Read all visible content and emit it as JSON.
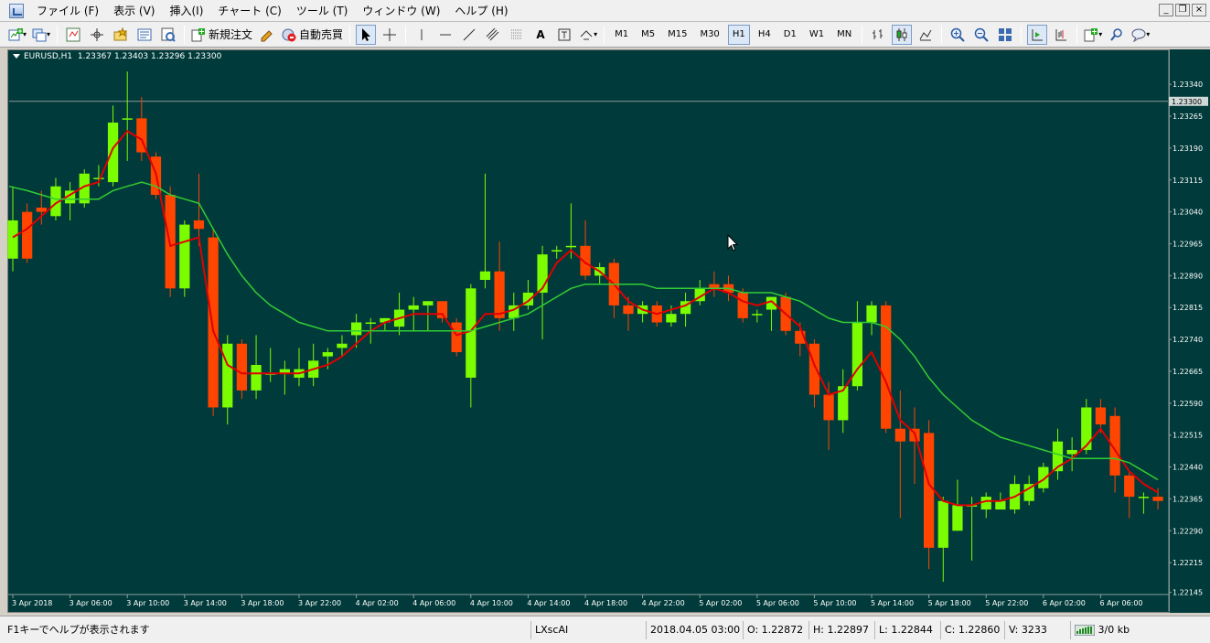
{
  "menu": {
    "items": [
      "ファイル (F)",
      "表示 (V)",
      "挿入(I)",
      "チャート (C)",
      "ツール (T)",
      "ウィンドウ (W)",
      "ヘルプ (H)"
    ]
  },
  "toolbar": {
    "new_order_label": "新規注文",
    "auto_trade_label": "自動売買",
    "text_tool_label": "A",
    "timeframes": [
      "M1",
      "M5",
      "M15",
      "M30",
      "H1",
      "H4",
      "D1",
      "W1",
      "MN"
    ],
    "active_timeframe": "H1"
  },
  "chart_header": {
    "symbol": "EURUSD,H1",
    "ohlc": "1.23367 1.23403 1.23296 1.23300"
  },
  "status": {
    "help": "F1キーでヘルプが表示されます",
    "profile": "LXscAI",
    "datetime": "2018.04.05 03:00",
    "open": "O: 1.22872",
    "high": "H: 1.22897",
    "low": "L: 1.22844",
    "close": "C: 1.22860",
    "volume": "V: 3233",
    "traffic": "3/0 kb"
  },
  "colors": {
    "background": "#003a3a",
    "bull": "#7cfc00",
    "bear": "#ff4500",
    "ma_fast": "#e00000",
    "ma_slow": "#32cd32",
    "axis_text": "#ffffff",
    "bid_line": "#8a9a9a"
  },
  "chart_data": {
    "type": "candlestick",
    "symbol": "EURUSD",
    "timeframe": "H1",
    "ylim": [
      1.2214,
      1.2342
    ],
    "y_ticks": [
      "1.23340",
      "1.23265",
      "1.23190",
      "1.23115",
      "1.23040",
      "1.22965",
      "1.22890",
      "1.22815",
      "1.22740",
      "1.22665",
      "1.22590",
      "1.22515",
      "1.22440",
      "1.22365",
      "1.22290",
      "1.22215",
      "1.22145"
    ],
    "current_price": "1.23300",
    "x_labels": [
      "3 Apr 2018",
      "3 Apr 06:00",
      "3 Apr 10:00",
      "3 Apr 14:00",
      "3 Apr 18:00",
      "3 Apr 22:00",
      "4 Apr 02:00",
      "4 Apr 06:00",
      "4 Apr 10:00",
      "4 Apr 14:00",
      "4 Apr 18:00",
      "4 Apr 22:00",
      "5 Apr 02:00",
      "5 Apr 06:00",
      "5 Apr 10:00",
      "5 Apr 14:00",
      "5 Apr 18:00",
      "5 Apr 22:00",
      "6 Apr 02:00",
      "6 Apr 06:00"
    ],
    "candles": [
      {
        "o": 1.2293,
        "h": 1.231,
        "l": 1.229,
        "c": 1.2302
      },
      {
        "o": 1.2304,
        "h": 1.2306,
        "l": 1.2292,
        "c": 1.2293
      },
      {
        "o": 1.2305,
        "h": 1.2309,
        "l": 1.2301,
        "c": 1.2304
      },
      {
        "o": 1.2303,
        "h": 1.2312,
        "l": 1.2302,
        "c": 1.231
      },
      {
        "o": 1.2306,
        "h": 1.2311,
        "l": 1.2302,
        "c": 1.2309
      },
      {
        "o": 1.2306,
        "h": 1.2314,
        "l": 1.2305,
        "c": 1.2313
      },
      {
        "o": 1.2312,
        "h": 1.2315,
        "l": 1.231,
        "c": 1.2312
      },
      {
        "o": 1.2311,
        "h": 1.2329,
        "l": 1.231,
        "c": 1.2325
      },
      {
        "o": 1.2326,
        "h": 1.2337,
        "l": 1.2316,
        "c": 1.2326
      },
      {
        "o": 1.2326,
        "h": 1.2331,
        "l": 1.2316,
        "c": 1.2318
      },
      {
        "o": 1.2317,
        "h": 1.2318,
        "l": 1.2307,
        "c": 1.2308
      },
      {
        "o": 1.2308,
        "h": 1.231,
        "l": 1.2284,
        "c": 1.2286
      },
      {
        "o": 1.2286,
        "h": 1.2302,
        "l": 1.2284,
        "c": 1.2301
      },
      {
        "o": 1.2302,
        "h": 1.2313,
        "l": 1.2296,
        "c": 1.23
      },
      {
        "o": 1.2298,
        "h": 1.23,
        "l": 1.2256,
        "c": 1.2258
      },
      {
        "o": 1.2258,
        "h": 1.2275,
        "l": 1.2254,
        "c": 1.2273
      },
      {
        "o": 1.2273,
        "h": 1.2274,
        "l": 1.226,
        "c": 1.2262
      },
      {
        "o": 1.2262,
        "h": 1.2275,
        "l": 1.226,
        "c": 1.2268
      },
      {
        "o": 1.2266,
        "h": 1.2272,
        "l": 1.2264,
        "c": 1.2266
      },
      {
        "o": 1.2266,
        "h": 1.2269,
        "l": 1.2261,
        "c": 1.2267
      },
      {
        "o": 1.2265,
        "h": 1.2272,
        "l": 1.2263,
        "c": 1.2267
      },
      {
        "o": 1.2265,
        "h": 1.2273,
        "l": 1.2263,
        "c": 1.2269
      },
      {
        "o": 1.227,
        "h": 1.2272,
        "l": 1.2267,
        "c": 1.2271
      },
      {
        "o": 1.2272,
        "h": 1.2275,
        "l": 1.227,
        "c": 1.2273
      },
      {
        "o": 1.2275,
        "h": 1.228,
        "l": 1.2272,
        "c": 1.2278
      },
      {
        "o": 1.2278,
        "h": 1.2279,
        "l": 1.2273,
        "c": 1.2278
      },
      {
        "o": 1.2278,
        "h": 1.2279,
        "l": 1.2276,
        "c": 1.2279
      },
      {
        "o": 1.2277,
        "h": 1.2285,
        "l": 1.2275,
        "c": 1.2281
      },
      {
        "o": 1.2281,
        "h": 1.2284,
        "l": 1.2276,
        "c": 1.2282
      },
      {
        "o": 1.2282,
        "h": 1.2283,
        "l": 1.2276,
        "c": 1.2283
      },
      {
        "o": 1.2283,
        "h": 1.2283,
        "l": 1.2278,
        "c": 1.2279
      },
      {
        "o": 1.2278,
        "h": 1.2279,
        "l": 1.227,
        "c": 1.2271
      },
      {
        "o": 1.2265,
        "h": 1.2287,
        "l": 1.2258,
        "c": 1.2286
      },
      {
        "o": 1.2288,
        "h": 1.2313,
        "l": 1.2286,
        "c": 1.229
      },
      {
        "o": 1.229,
        "h": 1.2297,
        "l": 1.2276,
        "c": 1.2279
      },
      {
        "o": 1.2279,
        "h": 1.2285,
        "l": 1.2276,
        "c": 1.2282
      },
      {
        "o": 1.2282,
        "h": 1.2288,
        "l": 1.2281,
        "c": 1.2285
      },
      {
        "o": 1.2285,
        "h": 1.2296,
        "l": 1.2274,
        "c": 1.2294
      },
      {
        "o": 1.2295,
        "h": 1.2296,
        "l": 1.2293,
        "c": 1.2295
      },
      {
        "o": 1.2296,
        "h": 1.2306,
        "l": 1.2293,
        "c": 1.2296
      },
      {
        "o": 1.2296,
        "h": 1.2302,
        "l": 1.2288,
        "c": 1.2289
      },
      {
        "o": 1.2289,
        "h": 1.2292,
        "l": 1.2287,
        "c": 1.2291
      },
      {
        "o": 1.2292,
        "h": 1.2293,
        "l": 1.2279,
        "c": 1.2282
      },
      {
        "o": 1.2282,
        "h": 1.2284,
        "l": 1.2276,
        "c": 1.228
      },
      {
        "o": 1.228,
        "h": 1.2283,
        "l": 1.2278,
        "c": 1.2282
      },
      {
        "o": 1.2282,
        "h": 1.2283,
        "l": 1.2277,
        "c": 1.2278
      },
      {
        "o": 1.2278,
        "h": 1.2282,
        "l": 1.2277,
        "c": 1.228
      },
      {
        "o": 1.228,
        "h": 1.2285,
        "l": 1.2277,
        "c": 1.2283
      },
      {
        "o": 1.2283,
        "h": 1.2288,
        "l": 1.2282,
        "c": 1.2286
      },
      {
        "o": 1.2287,
        "h": 1.229,
        "l": 1.2284,
        "c": 1.2286
      },
      {
        "o": 1.2287,
        "h": 1.2289,
        "l": 1.2283,
        "c": 1.2285
      },
      {
        "o": 1.2285,
        "h": 1.2286,
        "l": 1.2278,
        "c": 1.2279
      },
      {
        "o": 1.228,
        "h": 1.2281,
        "l": 1.2278,
        "c": 1.228
      },
      {
        "o": 1.2281,
        "h": 1.2284,
        "l": 1.2276,
        "c": 1.2284
      },
      {
        "o": 1.2284,
        "h": 1.2285,
        "l": 1.2275,
        "c": 1.2276
      },
      {
        "o": 1.2276,
        "h": 1.2278,
        "l": 1.227,
        "c": 1.2273
      },
      {
        "o": 1.2273,
        "h": 1.2274,
        "l": 1.2258,
        "c": 1.2261
      },
      {
        "o": 1.2261,
        "h": 1.2264,
        "l": 1.2248,
        "c": 1.2255
      },
      {
        "o": 1.2255,
        "h": 1.2267,
        "l": 1.2252,
        "c": 1.2263
      },
      {
        "o": 1.2263,
        "h": 1.2283,
        "l": 1.2262,
        "c": 1.2278
      },
      {
        "o": 1.2278,
        "h": 1.2283,
        "l": 1.2275,
        "c": 1.2282
      },
      {
        "o": 1.2282,
        "h": 1.2283,
        "l": 1.2252,
        "c": 1.2253
      },
      {
        "o": 1.2253,
        "h": 1.2262,
        "l": 1.2232,
        "c": 1.225
      },
      {
        "o": 1.2253,
        "h": 1.2258,
        "l": 1.224,
        "c": 1.225
      },
      {
        "o": 1.2252,
        "h": 1.2255,
        "l": 1.222,
        "c": 1.2225
      },
      {
        "o": 1.2225,
        "h": 1.2237,
        "l": 1.2217,
        "c": 1.2236
      },
      {
        "o": 1.2229,
        "h": 1.2241,
        "l": 1.2229,
        "c": 1.2235
      },
      {
        "o": 1.2235,
        "h": 1.2237,
        "l": 1.2222,
        "c": 1.2235
      },
      {
        "o": 1.2234,
        "h": 1.2238,
        "l": 1.2232,
        "c": 1.2237
      },
      {
        "o": 1.2234,
        "h": 1.2238,
        "l": 1.2234,
        "c": 1.2236
      },
      {
        "o": 1.2234,
        "h": 1.2242,
        "l": 1.2233,
        "c": 1.224
      },
      {
        "o": 1.2236,
        "h": 1.2242,
        "l": 1.2235,
        "c": 1.224
      },
      {
        "o": 1.2239,
        "h": 1.2245,
        "l": 1.2238,
        "c": 1.2244
      },
      {
        "o": 1.2243,
        "h": 1.2253,
        "l": 1.2241,
        "c": 1.225
      },
      {
        "o": 1.2247,
        "h": 1.2251,
        "l": 1.2243,
        "c": 1.2248
      },
      {
        "o": 1.2248,
        "h": 1.226,
        "l": 1.2247,
        "c": 1.2258
      },
      {
        "o": 1.2258,
        "h": 1.226,
        "l": 1.2252,
        "c": 1.2254
      },
      {
        "o": 1.2256,
        "h": 1.2258,
        "l": 1.2238,
        "c": 1.2242
      },
      {
        "o": 1.2242,
        "h": 1.2243,
        "l": 1.2232,
        "c": 1.2237
      },
      {
        "o": 1.2237,
        "h": 1.2238,
        "l": 1.2233,
        "c": 1.2237
      },
      {
        "o": 1.2237,
        "h": 1.2239,
        "l": 1.2234,
        "c": 1.2236
      }
    ],
    "series": [
      {
        "values": [
          1.2298,
          1.23,
          1.2303,
          1.2306,
          1.2308,
          1.231,
          1.2311,
          1.2319,
          1.2323,
          1.2321,
          1.2313,
          1.2296,
          1.2297,
          1.2298,
          1.2276,
          1.2268,
          1.2266,
          1.2266,
          1.2266,
          1.2266,
          1.2266,
          1.2267,
          1.2268,
          1.227,
          1.2273,
          1.2276,
          1.2278,
          1.2279,
          1.228,
          1.228,
          1.228,
          1.2275,
          1.2276,
          1.228,
          1.228,
          1.2281,
          1.2283,
          1.2286,
          1.2292,
          1.2295,
          1.2292,
          1.229,
          1.2287,
          1.2283,
          1.2281,
          1.228,
          1.2281,
          1.2282,
          1.2284,
          1.2286,
          1.2285,
          1.2283,
          1.2282,
          1.2283,
          1.228,
          1.2277,
          1.2268,
          1.2261,
          1.2262,
          1.2267,
          1.2271,
          1.2264,
          1.2255,
          1.2252,
          1.224,
          1.2236,
          1.2235,
          1.2235,
          1.2236,
          1.2236,
          1.2237,
          1.2239,
          1.2241,
          1.2244,
          1.2246,
          1.2249,
          1.2253,
          1.2248,
          1.2243,
          1.224,
          1.2238
        ]
      },
      {
        "values": [
          1.231,
          1.2309,
          1.2308,
          1.2307,
          1.2307,
          1.2307,
          1.2307,
          1.2309,
          1.231,
          1.2311,
          1.231,
          1.2308,
          1.2307,
          1.2306,
          1.23,
          1.2294,
          1.2289,
          1.2285,
          1.2282,
          1.228,
          1.2278,
          1.2277,
          1.2276,
          1.2276,
          1.2276,
          1.2276,
          1.2276,
          1.2276,
          1.2276,
          1.2276,
          1.2276,
          1.2276,
          1.2276,
          1.2277,
          1.2278,
          1.2279,
          1.228,
          1.2282,
          1.2284,
          1.2286,
          1.2287,
          1.2287,
          1.2287,
          1.2287,
          1.2287,
          1.2286,
          1.2286,
          1.2286,
          1.2286,
          1.2286,
          1.2286,
          1.2285,
          1.2285,
          1.2285,
          1.2284,
          1.2283,
          1.2281,
          1.2279,
          1.2278,
          1.2278,
          1.2278,
          1.2277,
          1.2274,
          1.227,
          1.2265,
          1.2261,
          1.2258,
          1.2255,
          1.2253,
          1.2251,
          1.225,
          1.2249,
          1.2248,
          1.2247,
          1.2246,
          1.2246,
          1.2246,
          1.2246,
          1.2245,
          1.2243,
          1.2241
        ]
      }
    ]
  }
}
